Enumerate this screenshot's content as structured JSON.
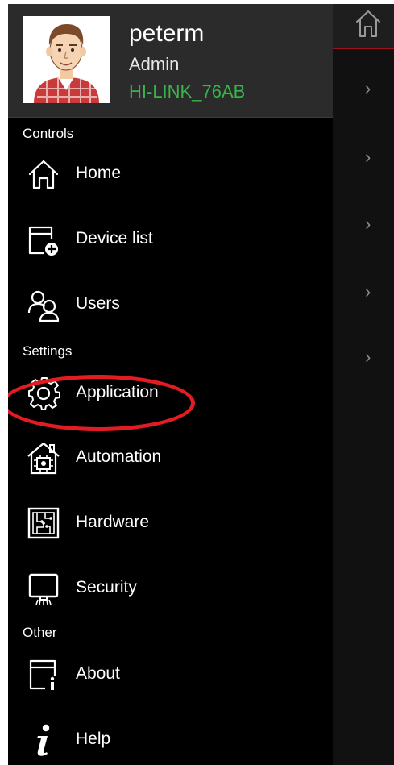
{
  "profile": {
    "username": "peterm",
    "role": "Admin",
    "network": "HI-LINK_76AB"
  },
  "sections": {
    "controls": "Controls",
    "settings": "Settings",
    "other": "Other"
  },
  "menu": {
    "home": "Home",
    "device_list": "Device list",
    "users": "Users",
    "application": "Application",
    "automation": "Automation",
    "hardware": "Hardware",
    "security": "Security",
    "about": "About",
    "help": "Help"
  },
  "background": {
    "chevron": "›"
  },
  "colors": {
    "drawer_bg": "#000000",
    "header_bg": "#2b2b2b",
    "network_text": "#39b34a",
    "highlight": "#e31b23",
    "topbar_accent": "#a0121b"
  },
  "icons": {
    "home": "home-icon",
    "device_list": "device-add-icon",
    "users": "users-icon",
    "application": "gear-icon",
    "automation": "house-automation-icon",
    "hardware": "circuit-board-icon",
    "security": "monitor-icon",
    "about": "window-info-icon",
    "help": "info-italic-icon",
    "chevron": "chevron-right-icon"
  }
}
